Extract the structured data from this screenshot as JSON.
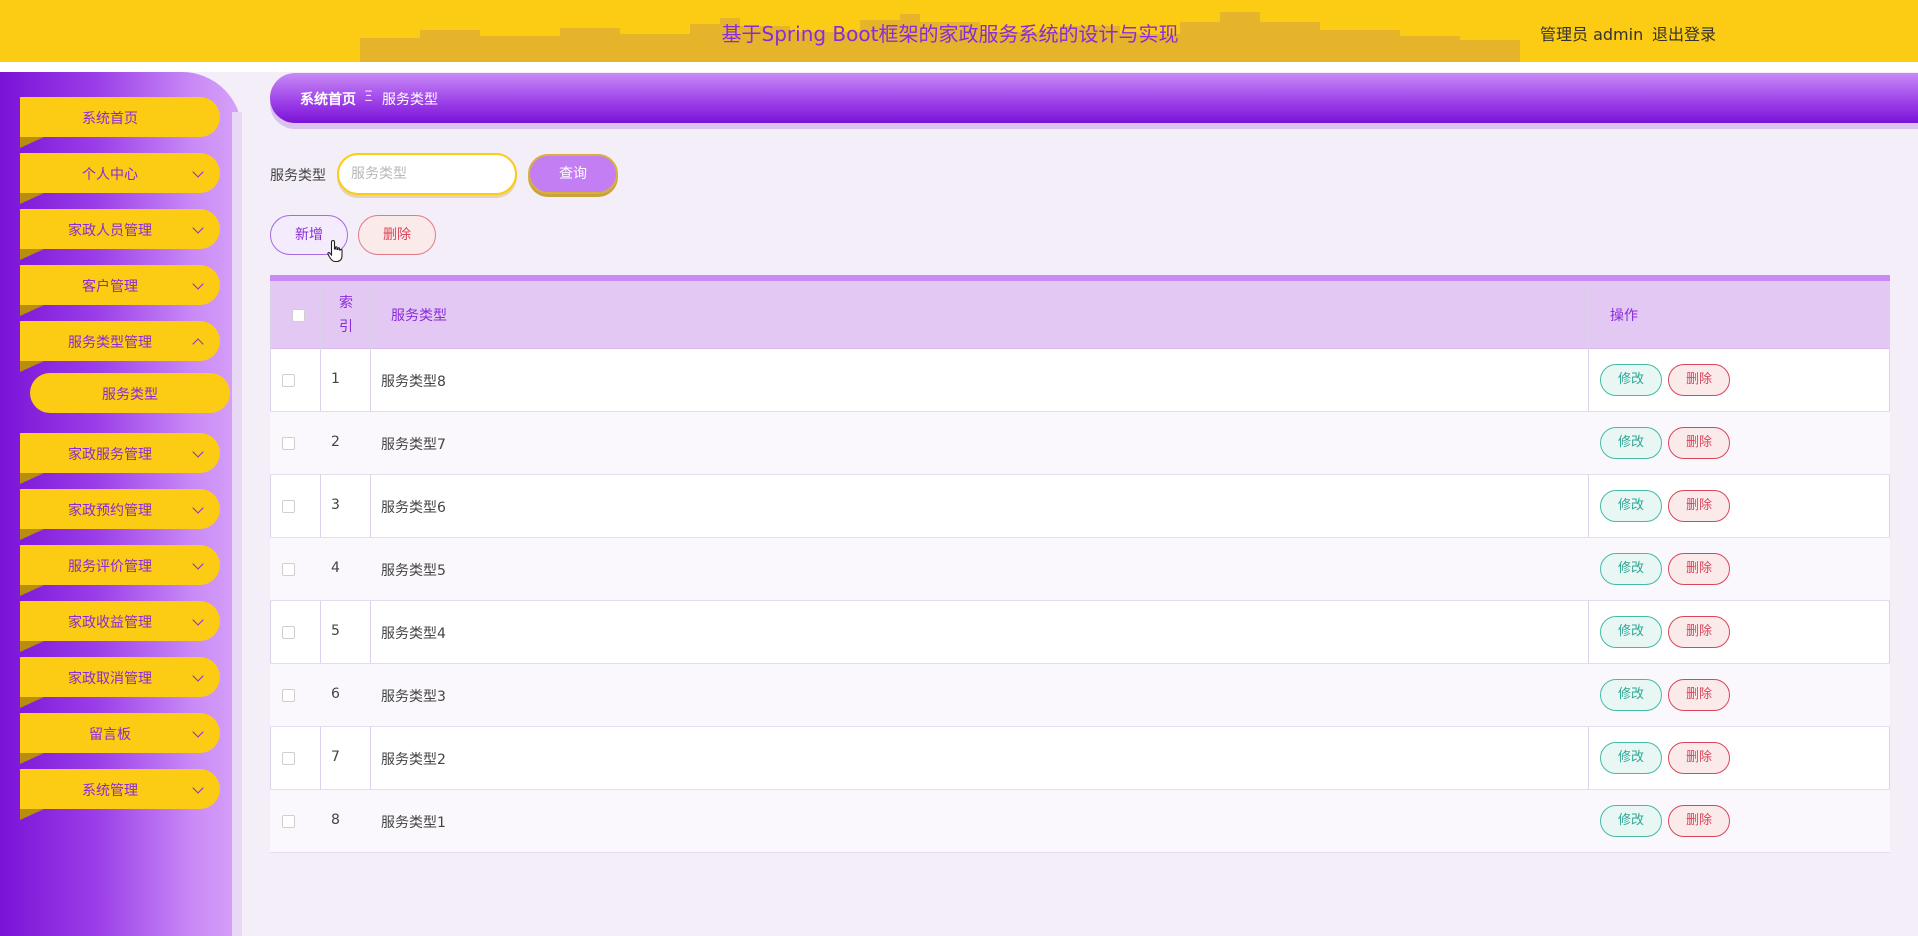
{
  "header": {
    "title": "基于Spring Boot框架的家政服务系统的设计与实现",
    "user": "管理员 admin",
    "logout": "退出登录",
    "colors": {
      "bar": "#fccb13",
      "title": "#8a2bd9"
    }
  },
  "sidebar": {
    "items": [
      {
        "label": "系统首页"
      },
      {
        "label": "个人中心"
      },
      {
        "label": "家政人员管理"
      },
      {
        "label": "客户管理"
      },
      {
        "label": "服务类型管理"
      },
      {
        "label": "家政服务管理"
      },
      {
        "label": "家政预约管理"
      },
      {
        "label": "服务评价管理"
      },
      {
        "label": "家政收益管理"
      },
      {
        "label": "家政取消管理"
      },
      {
        "label": "留言板"
      },
      {
        "label": "系统管理"
      }
    ],
    "submenu": {
      "label": "服务类型"
    }
  },
  "breadcrumb": {
    "home": "系统首页",
    "separator": "Ξ",
    "current": "服务类型"
  },
  "search": {
    "label": "服务类型",
    "placeholder": "服务类型",
    "button": "查询"
  },
  "actions": {
    "add": "新增",
    "delete": "删除"
  },
  "table": {
    "headers": {
      "index_top": "索",
      "index_bottom": "引",
      "type": "服务类型",
      "ops": "操作"
    },
    "edit_label": "修改",
    "delete_label": "删除",
    "rows": [
      {
        "index": "1",
        "type": "服务类型8"
      },
      {
        "index": "2",
        "type": "服务类型7"
      },
      {
        "index": "3",
        "type": "服务类型6"
      },
      {
        "index": "4",
        "type": "服务类型5"
      },
      {
        "index": "5",
        "type": "服务类型4"
      },
      {
        "index": "6",
        "type": "服务类型3"
      },
      {
        "index": "7",
        "type": "服务类型2"
      },
      {
        "index": "8",
        "type": "服务类型1"
      }
    ]
  }
}
